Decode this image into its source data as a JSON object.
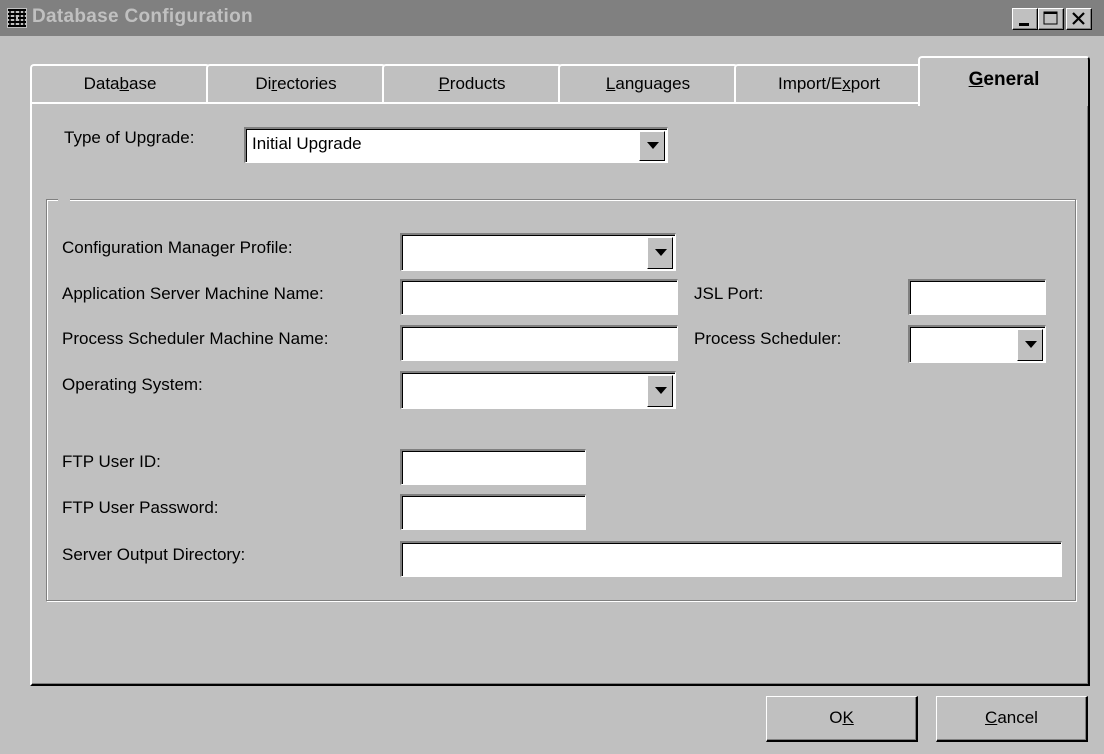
{
  "window": {
    "title": "Database Configuration"
  },
  "tabs": [
    {
      "label_pre": "Data",
      "mnemonic": "b",
      "label_post": "ase",
      "active": false
    },
    {
      "label_pre": "Di",
      "mnemonic": "r",
      "label_post": "ectories",
      "active": false
    },
    {
      "label_pre": "",
      "mnemonic": "P",
      "label_post": "roducts",
      "active": false
    },
    {
      "label_pre": "",
      "mnemonic": "L",
      "label_post": "anguages",
      "active": false
    },
    {
      "label_pre": "Import/E",
      "mnemonic": "x",
      "label_post": "port",
      "active": false
    },
    {
      "label_pre": "",
      "mnemonic": "G",
      "label_post": "eneral",
      "active": true
    }
  ],
  "upgrade": {
    "label": "Type of Upgrade:",
    "value": "Initial Upgrade"
  },
  "form": {
    "config_profile": {
      "label": "Configuration Manager Profile:",
      "value": ""
    },
    "app_server": {
      "label": "Application Server Machine Name:",
      "value": ""
    },
    "jsl_port": {
      "label": "JSL Port:",
      "value": ""
    },
    "proc_sched_machine": {
      "label": "Process Scheduler Machine Name:",
      "value": ""
    },
    "proc_scheduler": {
      "label": "Process Scheduler:",
      "value": ""
    },
    "os": {
      "label": "Operating System:",
      "value": ""
    },
    "ftp_user": {
      "label": "FTP User ID:",
      "value": ""
    },
    "ftp_password": {
      "label": "FTP User Password:",
      "value": ""
    },
    "server_output": {
      "label": "Server Output Directory:",
      "value": ""
    }
  },
  "buttons": {
    "ok": {
      "pre": "O",
      "mnemonic": "K",
      "post": ""
    },
    "cancel": {
      "pre": "",
      "mnemonic": "C",
      "post": "ancel"
    }
  },
  "icons": [
    "app-icon",
    "minimize-icon",
    "maximize-icon",
    "close-icon",
    "dropdown-arrow-icon"
  ]
}
